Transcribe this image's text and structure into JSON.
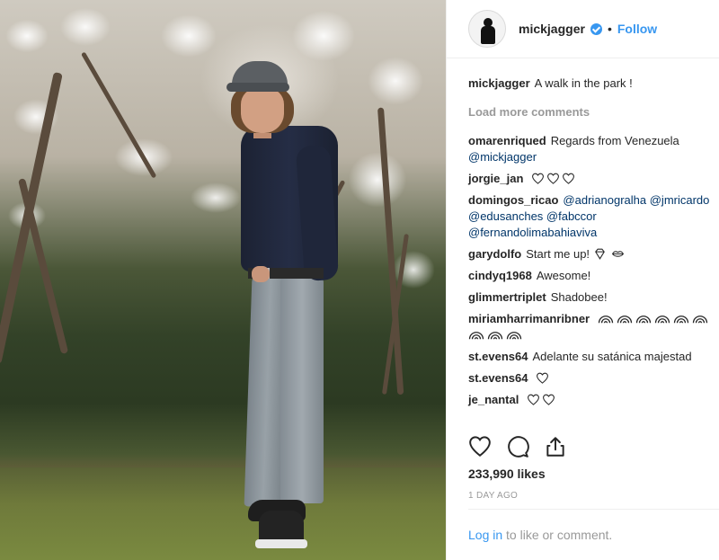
{
  "post": {
    "photo_alt": "man in dark shirt and grey jeans standing among blossoming magnolia trees",
    "username": "mickjagger",
    "follow_label": "Follow",
    "separator": "•",
    "caption": "A walk in the park !",
    "load_more": "Load more comments",
    "comments": [
      {
        "user": "omarenriqued",
        "text": "Regards from Venezuela",
        "line2": "@mickjagger"
      },
      {
        "user": "jorgie_jan",
        "text": ""
      },
      {
        "user": "domingos_ricao",
        "text": "@adrianogralha @jmricardo",
        "line2": "@edusanches @fabccor",
        "line3": "@fernandolimabahiaviva"
      },
      {
        "user": "garydolfo",
        "text": "Start me up!"
      },
      {
        "user": "cindyq1968",
        "text": "Awesome!"
      },
      {
        "user": "glimmertriplet",
        "text": "Shadobee!"
      },
      {
        "user": "miriamharrimanribner",
        "text": ""
      },
      {
        "user": "st.evens64",
        "text": "Adelante su satánica majestad"
      },
      {
        "user": "st.evens64",
        "text": ""
      },
      {
        "user": "je_nantal",
        "text": ""
      }
    ],
    "likes": "233,990 likes",
    "time": "1 DAY AGO",
    "login_link": "Log in",
    "login_rest": "to like or comment."
  },
  "icons": {
    "heart": "heart-icon",
    "comment": "comment-icon",
    "share": "share-icon",
    "verified": "verified-badge-icon"
  },
  "colors": {
    "accent": "#3897f0",
    "text": "#262626",
    "muted": "#999999",
    "mention": "#003569"
  }
}
